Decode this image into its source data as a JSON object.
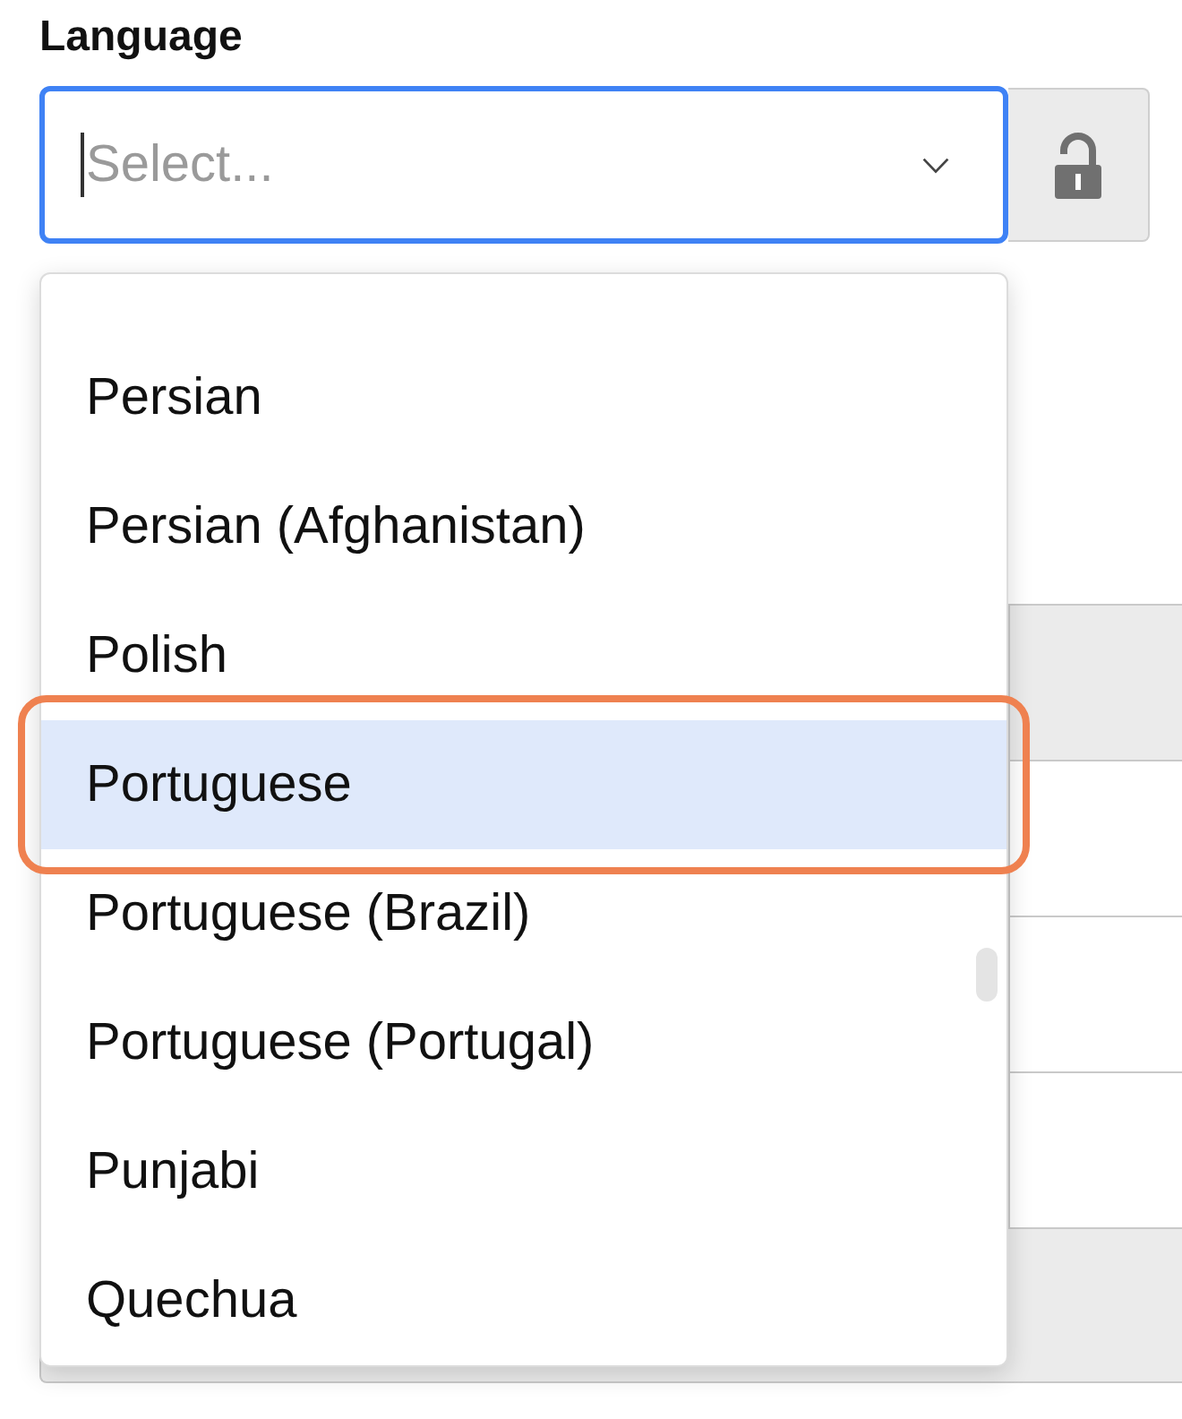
{
  "language_select": {
    "label": "Language",
    "placeholder": "Select...",
    "focused": true,
    "expanded": true,
    "lock": {
      "locked": false
    },
    "options": [
      {
        "label": "Persian",
        "selected": false,
        "outlined": false
      },
      {
        "label": "Persian (Afghanistan)",
        "selected": false,
        "outlined": false
      },
      {
        "label": "Polish",
        "selected": false,
        "outlined": false
      },
      {
        "label": "Portuguese",
        "selected": true,
        "outlined": true
      },
      {
        "label": "Portuguese (Brazil)",
        "selected": false,
        "outlined": false
      },
      {
        "label": "Portuguese (Portugal)",
        "selected": false,
        "outlined": false
      },
      {
        "label": "Punjabi",
        "selected": false,
        "outlined": false
      },
      {
        "label": "Quechua",
        "selected": false,
        "outlined": false
      }
    ]
  },
  "fields_below": [
    {
      "disabled": true
    },
    {
      "disabled": false
    },
    {
      "disabled": false
    },
    {
      "disabled": false
    },
    {
      "disabled": true
    }
  ]
}
